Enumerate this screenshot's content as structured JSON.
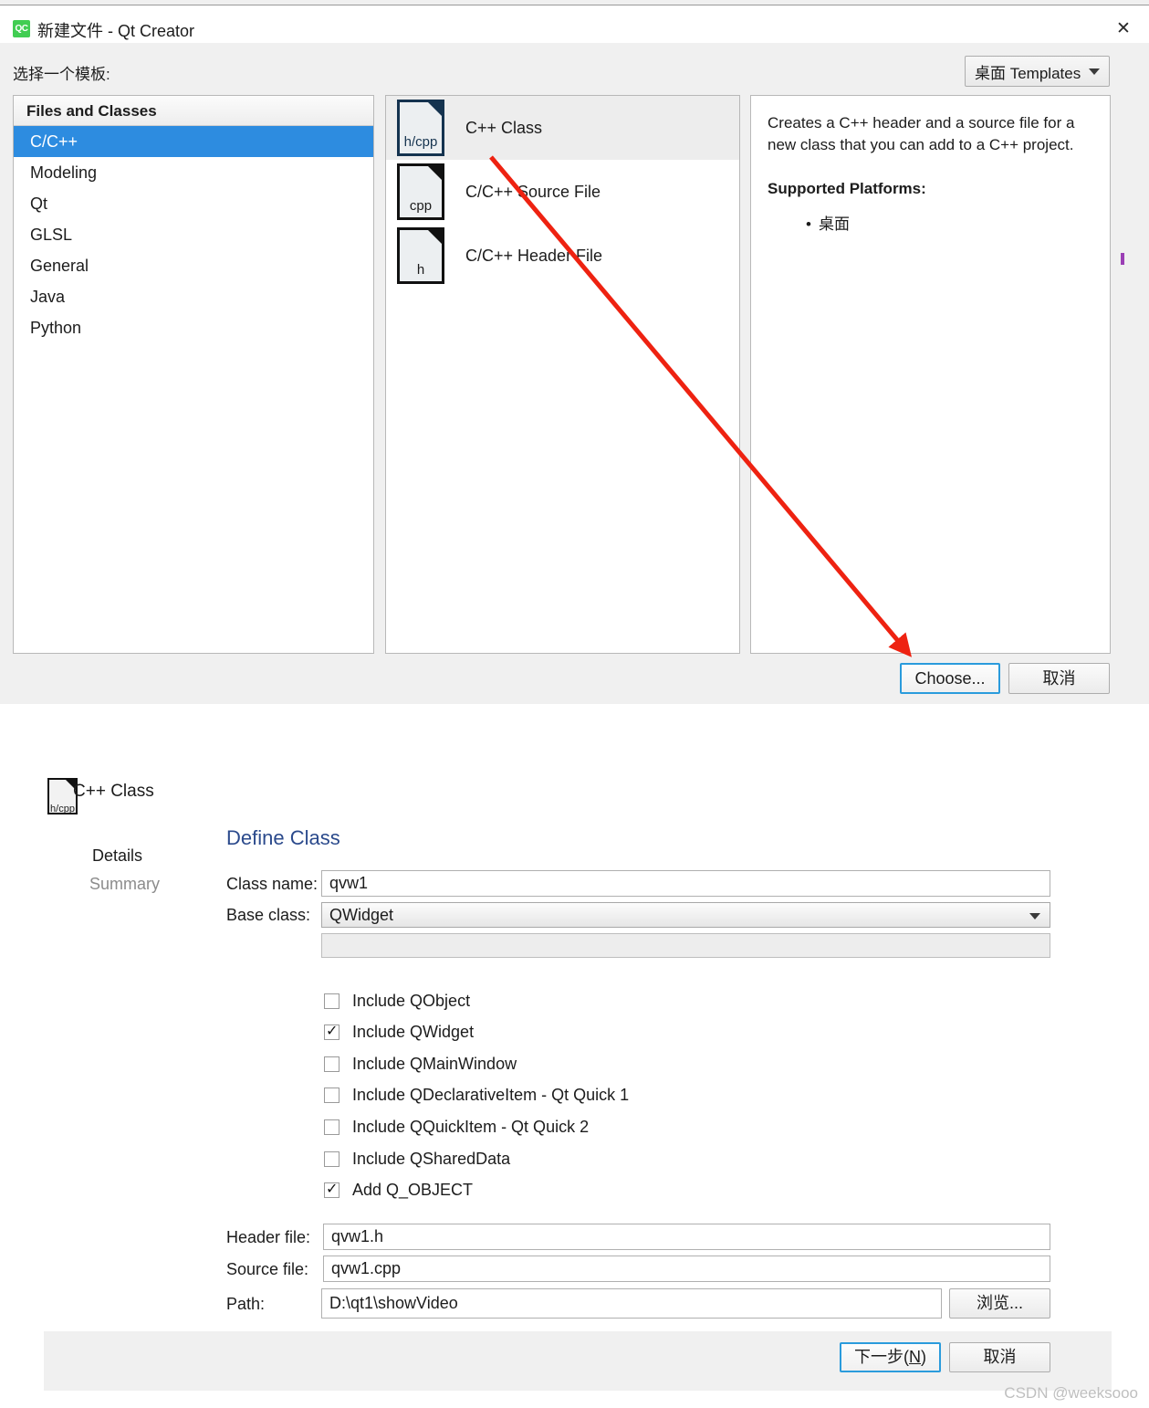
{
  "window": {
    "title": "新建文件 - Qt Creator",
    "icon": "qt-creator-icon",
    "icon_text": "QC",
    "close_icon": "✕"
  },
  "top_dialog": {
    "prompt_label": "选择一个模板:",
    "templates_combo": {
      "value": "桌面 Templates",
      "icon": "chevron-down-icon"
    },
    "categories": {
      "header": "Files and Classes",
      "items": [
        {
          "label": "C/C++",
          "selected": true
        },
        {
          "label": "Modeling",
          "selected": false
        },
        {
          "label": "Qt",
          "selected": false
        },
        {
          "label": "GLSL",
          "selected": false
        },
        {
          "label": "General",
          "selected": false
        },
        {
          "label": "Java",
          "selected": false
        },
        {
          "label": "Python",
          "selected": false
        }
      ]
    },
    "templates": [
      {
        "label": "C++ Class",
        "icon_ext": "h/cpp",
        "selected": true
      },
      {
        "label": "C/C++ Source File",
        "icon_ext": "cpp",
        "selected": false
      },
      {
        "label": "C/C++ Header File",
        "icon_ext": "h",
        "selected": false
      }
    ],
    "description": {
      "text": "Creates a C++ header and a source file for a new class that you can add to a C++ project.",
      "platforms_heading": "Supported Platforms:",
      "platforms": [
        "桌面"
      ]
    },
    "buttons": {
      "choose": "Choose...",
      "cancel": "取消"
    }
  },
  "annotation": {
    "color": "#ee2211",
    "shape": "arrow",
    "from": [
      538,
      172
    ],
    "to": [
      997,
      716
    ]
  },
  "wizard": {
    "title": "C++ Class",
    "title_icon_ext": "h/cpp",
    "steps": [
      {
        "label": "Details",
        "current": true
      },
      {
        "label": "Summary",
        "current": false
      }
    ],
    "page_heading": "Define Class",
    "fields": {
      "class_name_label": "Class name:",
      "class_name_value": "qvw1",
      "base_class_label": "Base class:",
      "base_class_value": "QWidget",
      "extra_value": "",
      "header_file_label": "Header file:",
      "header_file_value": "qvw1.h",
      "source_file_label": "Source file:",
      "source_file_value": "qvw1.cpp",
      "path_label": "Path:",
      "path_value": "D:\\qt1\\showVideo",
      "browse_button": "浏览..."
    },
    "checkboxes": [
      {
        "label": "Include QObject",
        "checked": false
      },
      {
        "label": "Include QWidget",
        "checked": true
      },
      {
        "label": "Include QMainWindow",
        "checked": false
      },
      {
        "label": "Include QDeclarativeItem - Qt Quick 1",
        "checked": false
      },
      {
        "label": "Include QQuickItem - Qt Quick 2",
        "checked": false
      },
      {
        "label": "Include QSharedData",
        "checked": false
      },
      {
        "label": "Add Q_OBJECT",
        "checked": true
      }
    ],
    "buttons": {
      "next": "下一步(N)",
      "next_mnemonic": "N",
      "cancel": "取消"
    }
  },
  "watermark": "CSDN @weeksooo",
  "colors": {
    "accent_blue": "#2d8ce0",
    "heading_blue": "#2b4a8c",
    "annotation_red": "#ee2211",
    "qt_green": "#41cd52"
  }
}
